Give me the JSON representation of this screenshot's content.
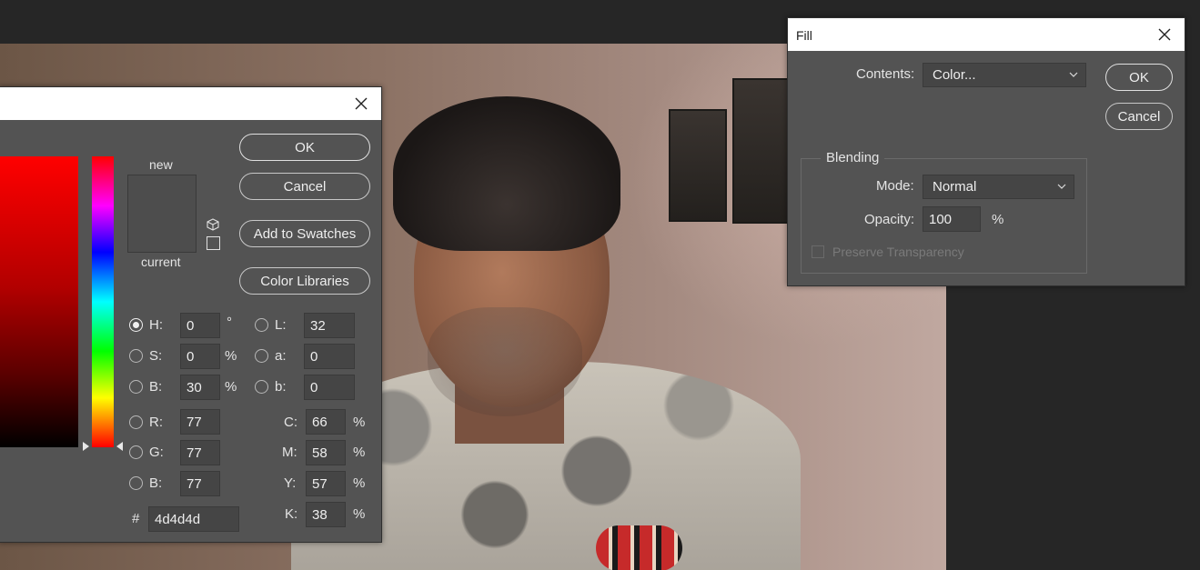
{
  "color_picker": {
    "title": "",
    "buttons": {
      "ok": "OK",
      "cancel": "Cancel",
      "add_to_swatches": "Add to Swatches",
      "color_libraries": "Color Libraries"
    },
    "swatch_labels": {
      "new": "new",
      "current": "current"
    },
    "new_color": "#4d4d4d",
    "current_color": "#4d4d4d",
    "hsb": {
      "h_label": "H:",
      "h": "0",
      "h_unit": "°",
      "s_label": "S:",
      "s": "0",
      "s_unit": "%",
      "b_label": "B:",
      "b": "30",
      "b_unit": "%"
    },
    "lab": {
      "l_label": "L:",
      "l": "32",
      "a_label": "a:",
      "a": "0",
      "b_label": "b:",
      "b": "0"
    },
    "rgb": {
      "r_label": "R:",
      "r": "77",
      "g_label": "G:",
      "g": "77",
      "b_label": "B:",
      "b": "77"
    },
    "cmyk": {
      "c_label": "C:",
      "c": "66",
      "m_label": "M:",
      "m": "58",
      "y_label": "Y:",
      "y": "57",
      "k_label": "K:",
      "k": "38",
      "unit": "%"
    },
    "hex": {
      "label": "#",
      "value": "4d4d4d"
    },
    "selected_mode": "H"
  },
  "fill": {
    "title": "Fill",
    "contents_label": "Contents:",
    "contents_value": "Color...",
    "buttons": {
      "ok": "OK",
      "cancel": "Cancel"
    },
    "blending": {
      "title": "Blending",
      "mode_label": "Mode:",
      "mode_value": "Normal",
      "opacity_label": "Opacity:",
      "opacity_value": "100",
      "opacity_unit": "%",
      "preserve_label": "Preserve Transparency",
      "preserve_checked": false
    }
  },
  "icons": [
    "close-icon",
    "chevron-down-icon",
    "gamut-cube-icon"
  ]
}
